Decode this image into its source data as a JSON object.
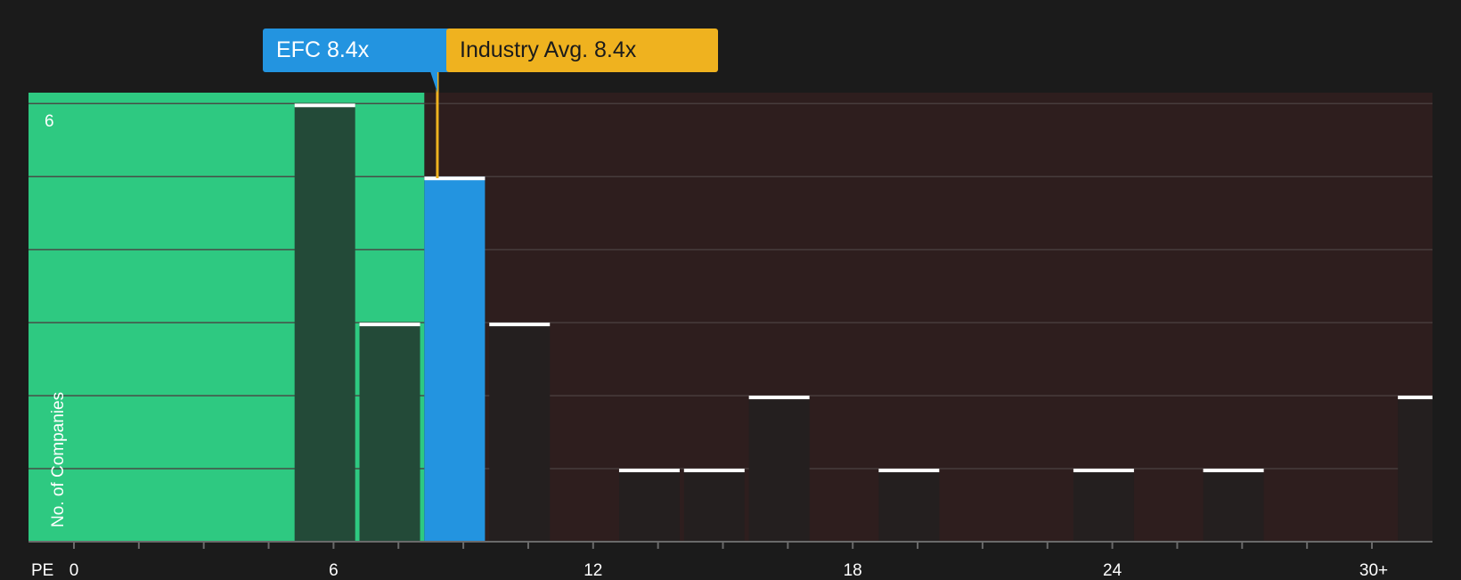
{
  "chart_data": {
    "type": "bar",
    "title": "",
    "xlabel": "PE",
    "ylabel": "No. of Companies",
    "x_bin_starts": [
      5.1,
      6.6,
      8.1,
      9.6,
      12.6,
      14.1,
      15.6,
      18.6,
      23.1,
      26.1,
      30.6
    ],
    "values": [
      6,
      3,
      5,
      3,
      1,
      1,
      2,
      1,
      1,
      1,
      2
    ],
    "bin_width": 1.4,
    "highlight_bin_start": 8.1,
    "xlim": [
      -1.05,
      31.4
    ],
    "ylim": [
      0,
      6.15
    ],
    "x_ticks": [
      0,
      6,
      12,
      18,
      24,
      30
    ],
    "x_tick_labels": [
      "0",
      "6",
      "12",
      "18",
      "24",
      "30+"
    ],
    "y_tick_labels": [
      "6"
    ],
    "company": {
      "label": "EFC 8.4x",
      "value": 8.4
    },
    "industry_avg": {
      "label": "Industry Avg. 8.4x",
      "value": 8.4
    },
    "undervalued_region_end": 8.1,
    "grid": true,
    "colors": {
      "background": "#1b1b1b",
      "undervalued_region": "#2ec981",
      "overvalued_region": "#2e1e1e",
      "highlight_bar": "#2394e0",
      "bar_on_green": "#234a38",
      "bar_on_dark": "#241f1f",
      "bar_cap": "#ffffff",
      "industry_marker": "#efb21f",
      "gridline": "#4a4040",
      "axis": "#6a6a6a"
    }
  }
}
